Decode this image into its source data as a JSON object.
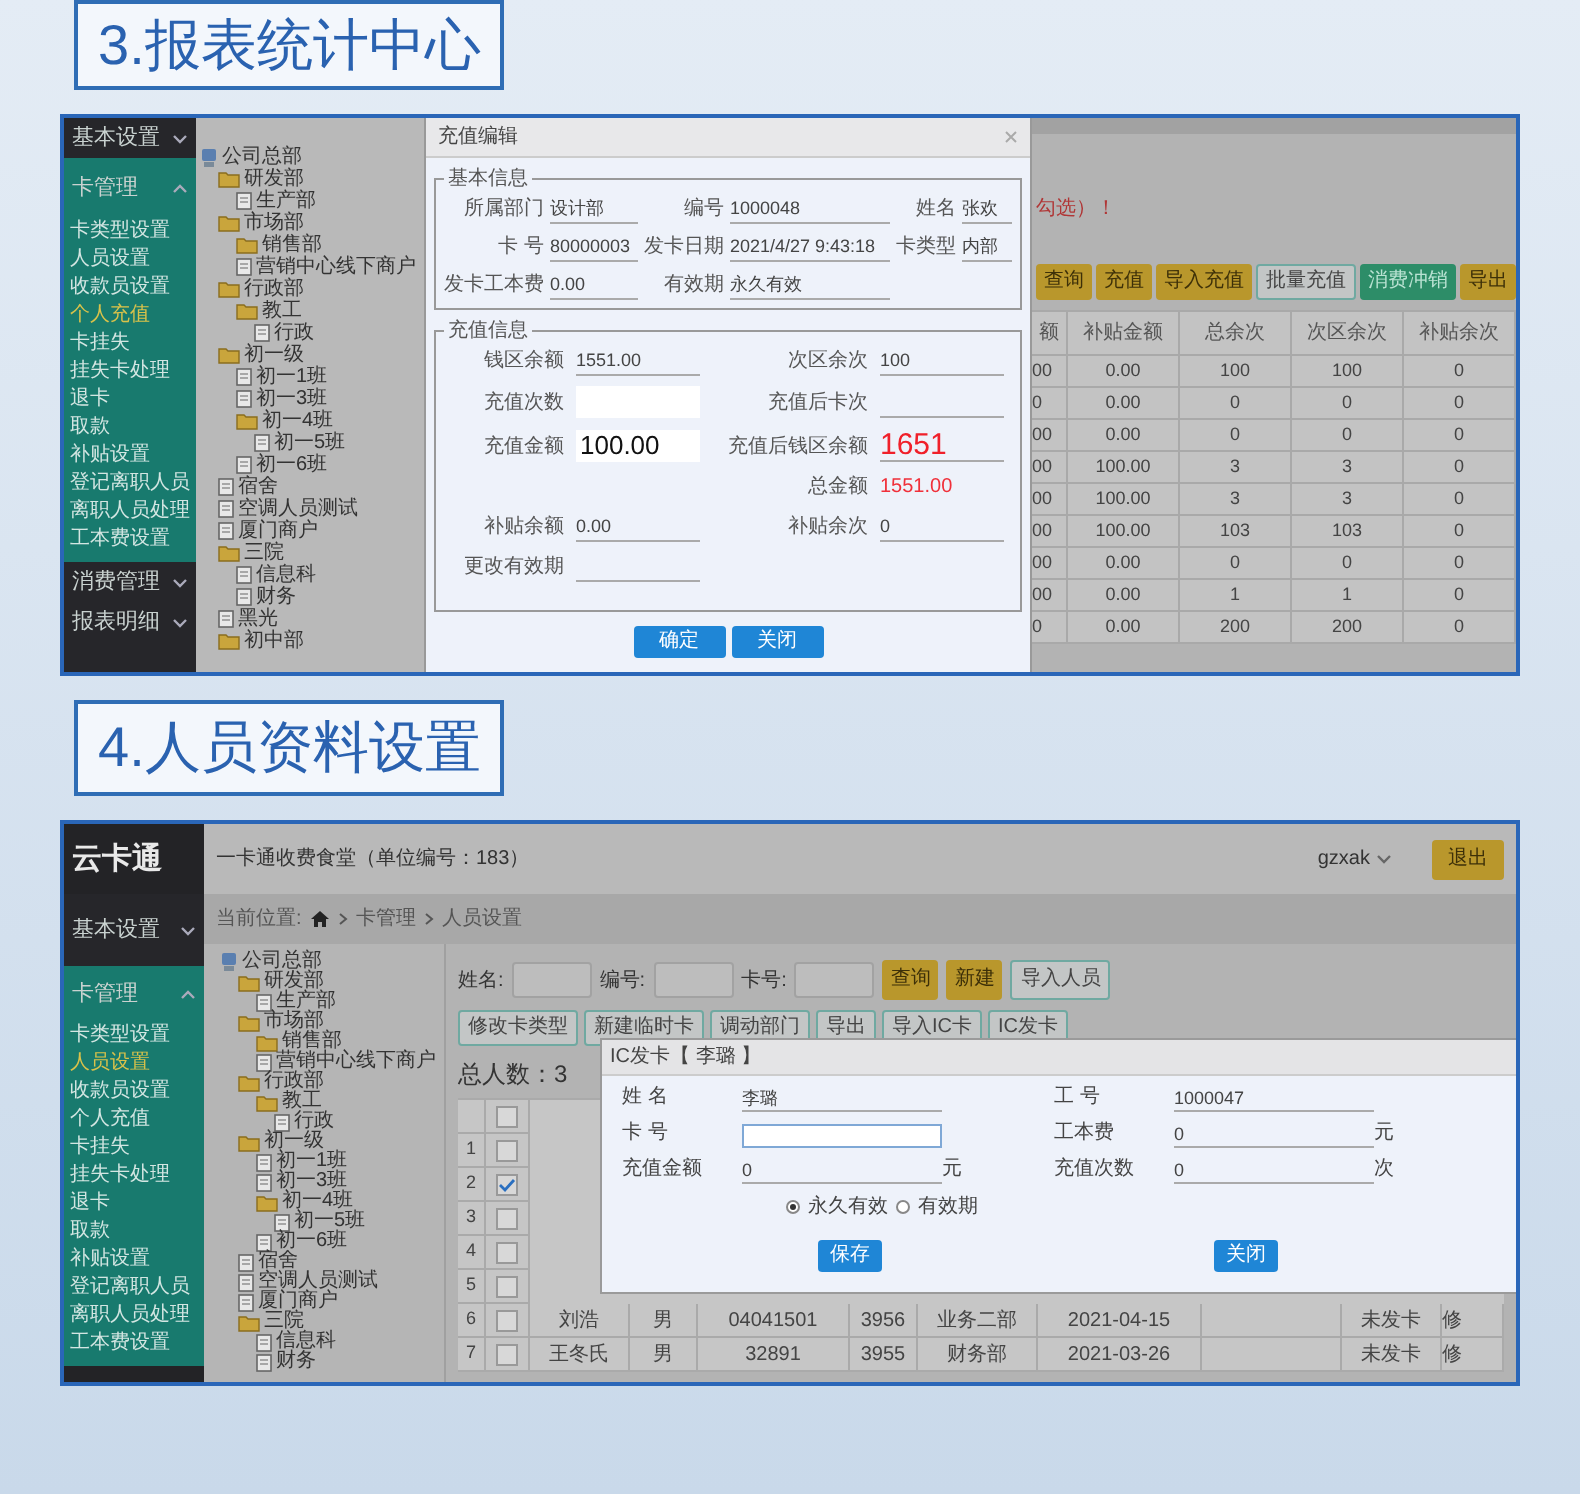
{
  "section_3": {
    "heading": "3.报表统计中心",
    "sidebar": {
      "groups": [
        {
          "label": "基本设置",
          "expanded": false
        },
        {
          "label": "卡管理",
          "expanded": true,
          "items": [
            {
              "label": "卡类型设置",
              "selected": false
            },
            {
              "label": "人员设置",
              "selected": false
            },
            {
              "label": "收款员设置",
              "selected": false
            },
            {
              "label": "个人充值",
              "selected": true
            },
            {
              "label": "卡挂失",
              "selected": false
            },
            {
              "label": "挂失卡处理",
              "selected": false
            },
            {
              "label": "退卡",
              "selected": false
            },
            {
              "label": "取款",
              "selected": false
            },
            {
              "label": "补贴设置",
              "selected": false
            },
            {
              "label": "登记离职人员",
              "selected": false
            },
            {
              "label": "离职人员处理",
              "selected": false
            },
            {
              "label": "工本费设置",
              "selected": false
            }
          ]
        },
        {
          "label": "消费管理",
          "expanded": false
        },
        {
          "label": "报表明细",
          "expanded": false
        }
      ]
    },
    "tree": [
      {
        "label": "公司总部",
        "kind": "root",
        "children": [
          {
            "label": "研发部",
            "kind": "folder",
            "children": [
              {
                "label": "生产部",
                "kind": "file"
              }
            ]
          },
          {
            "label": "市场部",
            "kind": "folder",
            "children": [
              {
                "label": "销售部",
                "kind": "folder"
              },
              {
                "label": "营销中心线下商户",
                "kind": "file"
              }
            ]
          },
          {
            "label": "行政部",
            "kind": "folder",
            "children": [
              {
                "label": "教工",
                "kind": "folder",
                "children": [
                  {
                    "label": "行政",
                    "kind": "file"
                  }
                ]
              }
            ]
          },
          {
            "label": "初一级",
            "kind": "folder",
            "children": [
              {
                "label": "初一1班",
                "kind": "file"
              },
              {
                "label": "初一3班",
                "kind": "file"
              },
              {
                "label": "初一4班",
                "kind": "folder",
                "children": [
                  {
                    "label": "初一5班",
                    "kind": "file"
                  }
                ]
              },
              {
                "label": "初一6班",
                "kind": "file"
              }
            ]
          },
          {
            "label": "宿舍",
            "kind": "file"
          },
          {
            "label": "空调人员测试",
            "kind": "file"
          },
          {
            "label": "厦门商户",
            "kind": "file"
          },
          {
            "label": "三院",
            "kind": "folder",
            "children": [
              {
                "label": "信息科",
                "kind": "file"
              },
              {
                "label": "财务",
                "kind": "file"
              }
            ]
          },
          {
            "label": "黑光",
            "kind": "file"
          },
          {
            "label": "初中部",
            "kind": "folder"
          }
        ]
      }
    ],
    "dialog": {
      "title": "充值编辑",
      "basic": {
        "legend": "基本信息",
        "rows": [
          [
            {
              "label": "所属部门",
              "value": "设计部"
            },
            {
              "label": "编号",
              "value": "1000048"
            },
            {
              "label": "姓名",
              "value": "张欢"
            }
          ],
          [
            {
              "label": "卡 号",
              "value": "80000003"
            },
            {
              "label": "发卡日期",
              "value": "2021/4/27 9:43:18"
            },
            {
              "label": "卡类型",
              "value": "内部"
            }
          ],
          [
            {
              "label": "发卡工本费",
              "value": "0.00"
            },
            {
              "label": "有效期",
              "value": "永久有效"
            }
          ]
        ]
      },
      "recharge": {
        "legend": "充值信息",
        "rows": [
          {
            "left": {
              "label": "钱区余额",
              "value": "1551.00",
              "kind": "line"
            },
            "right": {
              "label": "次区余次",
              "value": "100",
              "kind": "line"
            }
          },
          {
            "left": {
              "label": "充值次数",
              "kind": "box"
            },
            "right": {
              "label": "充值后卡次",
              "kind": "line"
            }
          },
          {
            "left": {
              "label": "充值金额",
              "value": "100.00",
              "kind": "box"
            },
            "right": {
              "label": "充值后钱区余额",
              "value": "1651",
              "kind": "big-red"
            }
          },
          {
            "right": {
              "label": "总金额",
              "value": "1551.00",
              "kind": "plain-red"
            }
          },
          {
            "left": {
              "label": "补贴余额",
              "value": "0.00",
              "kind": "line"
            },
            "right": {
              "label": "补贴余次",
              "value": "0",
              "kind": "line"
            }
          },
          {
            "left": {
              "label": "更改有效期",
              "kind": "line"
            }
          }
        ]
      },
      "buttons": [
        "确定",
        "关闭"
      ]
    },
    "notice": "勾选）！",
    "toolbar": [
      {
        "label": "查询",
        "kind": "primary"
      },
      {
        "label": "充值",
        "kind": "primary"
      },
      {
        "label": "导入充值",
        "kind": "primary"
      },
      {
        "label": "批量充值",
        "kind": "outline"
      },
      {
        "label": "消费冲销",
        "kind": "success"
      },
      {
        "label": "导出",
        "kind": "primary"
      }
    ],
    "table": {
      "columns": [
        "额",
        "补贴金额",
        "总余次",
        "次区余次",
        "补贴余次"
      ],
      "rows": [
        [
          "00",
          "0.00",
          "100",
          "100",
          "0"
        ],
        [
          "0",
          "0.00",
          "0",
          "0",
          "0"
        ],
        [
          "00",
          "0.00",
          "0",
          "0",
          "0"
        ],
        [
          "00",
          "100.00",
          "3",
          "3",
          "0"
        ],
        [
          "00",
          "100.00",
          "3",
          "3",
          "0"
        ],
        [
          "00",
          "100.00",
          "103",
          "103",
          "0"
        ],
        [
          "00",
          "0.00",
          "0",
          "0",
          "0"
        ],
        [
          "00",
          "0.00",
          "1",
          "1",
          "0"
        ],
        [
          "0",
          "0.00",
          "200",
          "200",
          "0"
        ]
      ]
    }
  },
  "section_4": {
    "heading": "4.人员资料设置",
    "logo": "云卡通",
    "header": {
      "title": "一卡通收费食堂（单位编号：183）",
      "user": "gzxak",
      "logout": "退出"
    },
    "breadcrumb": {
      "label": "当前位置:",
      "items": [
        "卡管理",
        "人员设置"
      ]
    },
    "sidebar": {
      "groups": [
        {
          "label": "基本设置",
          "expanded": false
        },
        {
          "label": "卡管理",
          "expanded": true,
          "items": [
            {
              "label": "卡类型设置",
              "selected": false
            },
            {
              "label": "人员设置",
              "selected": true
            },
            {
              "label": "收款员设置",
              "selected": false
            },
            {
              "label": "个人充值",
              "selected": false
            },
            {
              "label": "卡挂失",
              "selected": false
            },
            {
              "label": "挂失卡处理",
              "selected": false
            },
            {
              "label": "退卡",
              "selected": false
            },
            {
              "label": "取款",
              "selected": false
            },
            {
              "label": "补贴设置",
              "selected": false
            },
            {
              "label": "登记离职人员",
              "selected": false
            },
            {
              "label": "离职人员处理",
              "selected": false
            },
            {
              "label": "工本费设置",
              "selected": false
            }
          ]
        }
      ]
    },
    "tree": [
      {
        "label": "公司总部",
        "kind": "root",
        "children": [
          {
            "label": "研发部",
            "kind": "folder",
            "children": [
              {
                "label": "生产部",
                "kind": "file"
              }
            ]
          },
          {
            "label": "市场部",
            "kind": "folder",
            "children": [
              {
                "label": "销售部",
                "kind": "folder"
              },
              {
                "label": "营销中心线下商户",
                "kind": "file"
              }
            ]
          },
          {
            "label": "行政部",
            "kind": "folder",
            "children": [
              {
                "label": "教工",
                "kind": "folder",
                "children": [
                  {
                    "label": "行政",
                    "kind": "file"
                  }
                ]
              }
            ]
          },
          {
            "label": "初一级",
            "kind": "folder",
            "children": [
              {
                "label": "初一1班",
                "kind": "file"
              },
              {
                "label": "初一3班",
                "kind": "file"
              },
              {
                "label": "初一4班",
                "kind": "folder",
                "children": [
                  {
                    "label": "初一5班",
                    "kind": "file"
                  }
                ]
              },
              {
                "label": "初一6班",
                "kind": "file"
              }
            ]
          },
          {
            "label": "宿舍",
            "kind": "file"
          },
          {
            "label": "空调人员测试",
            "kind": "file"
          },
          {
            "label": "厦门商户",
            "kind": "file"
          },
          {
            "label": "三院",
            "kind": "folder",
            "children": [
              {
                "label": "信息科",
                "kind": "file"
              },
              {
                "label": "财务",
                "kind": "file"
              }
            ]
          }
        ]
      }
    ],
    "search": {
      "fields": [
        {
          "label": "姓名:"
        },
        {
          "label": "编号:"
        },
        {
          "label": "卡号:"
        }
      ],
      "buttons": [
        {
          "label": "查询",
          "kind": "primary"
        },
        {
          "label": "新建",
          "kind": "primary"
        },
        {
          "label": "导入人员",
          "kind": "outline"
        }
      ]
    },
    "actions": [
      {
        "label": "修改卡类型",
        "kind": "outline"
      },
      {
        "label": "新建临时卡",
        "kind": "outline"
      },
      {
        "label": "调动部门",
        "kind": "outline"
      },
      {
        "label": "导出",
        "kind": "outline"
      },
      {
        "label": "导入IC卡",
        "kind": "outline"
      },
      {
        "label": "IC发卡",
        "kind": "outline"
      }
    ],
    "total": "总人数：3",
    "table": {
      "select_all": {
        "checked": false
      },
      "rows": [
        {
          "index": "1",
          "checked": false
        },
        {
          "index": "2",
          "checked": true
        },
        {
          "index": "3",
          "checked": false
        },
        {
          "index": "4",
          "checked": false
        },
        {
          "index": "5",
          "checked": false
        },
        {
          "index": "6",
          "checked": false,
          "cells": [
            "刘浩",
            "男",
            "04041501",
            "3956",
            "业务二部",
            "2021-04-15",
            "",
            "未发卡",
            "修"
          ]
        },
        {
          "index": "7",
          "checked": false,
          "cells": [
            "王冬氏",
            "男",
            "32891",
            "3955",
            "财务部",
            "2021-03-26",
            "",
            "未发卡",
            "修"
          ]
        }
      ]
    },
    "dialog": {
      "title": "IC发卡【 李璐 】",
      "rows": [
        {
          "left": {
            "label": "姓 名",
            "value": "李璐",
            "kind": "line"
          },
          "right": {
            "label": "工 号",
            "value": "1000047",
            "kind": "line"
          }
        },
        {
          "left": {
            "label": "卡 号",
            "kind": "focus-box"
          },
          "right": {
            "label": "工本费",
            "value": "0",
            "unit": "元",
            "kind": "line"
          }
        },
        {
          "left": {
            "label": "充值金额",
            "value": "0",
            "unit": "元",
            "kind": "line"
          },
          "right": {
            "label": "充值次数",
            "value": "0",
            "unit": "次",
            "kind": "line"
          }
        }
      ],
      "validity": [
        {
          "label": "永久有效",
          "selected": true
        },
        {
          "label": "有效期",
          "selected": false
        }
      ],
      "buttons": [
        "保存",
        "关闭"
      ]
    }
  }
}
